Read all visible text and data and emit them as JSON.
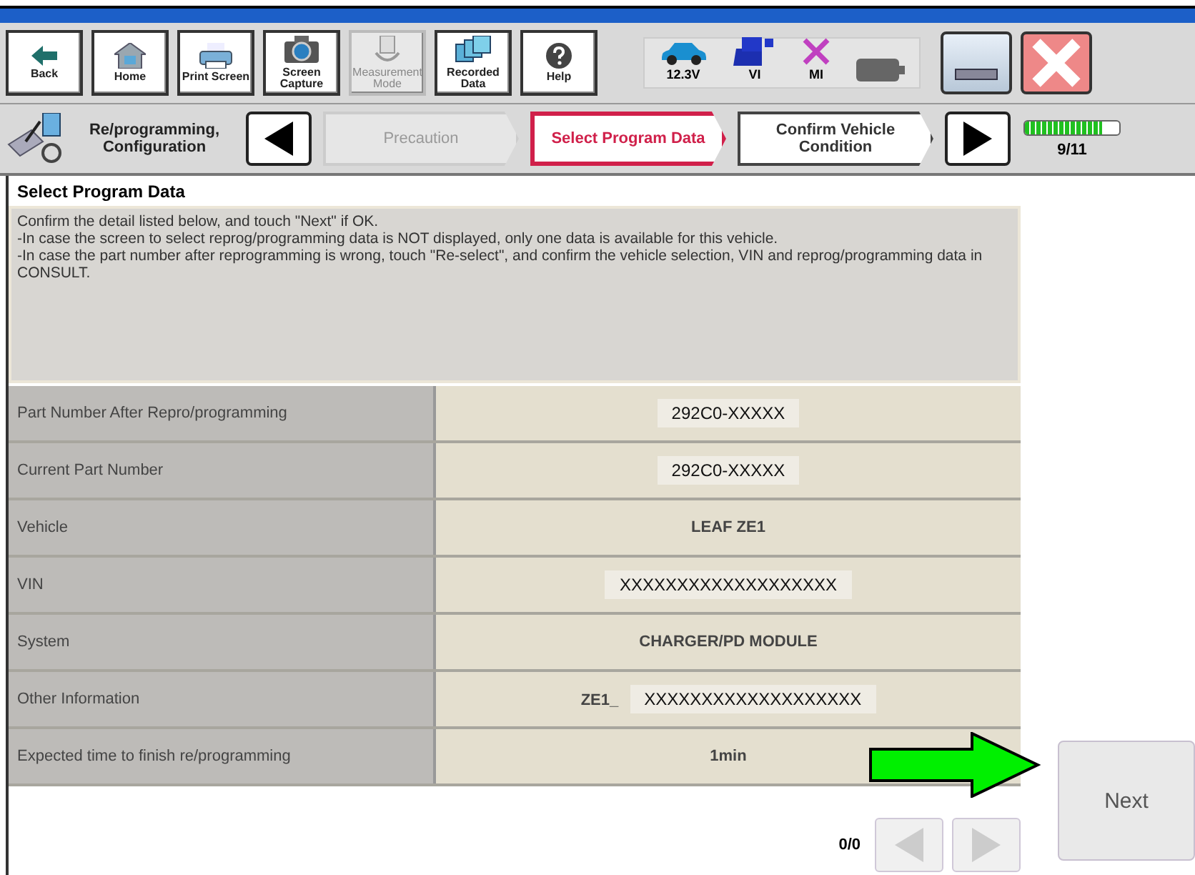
{
  "toolbar": {
    "buttons": [
      {
        "label": "Back",
        "kind": "back",
        "disabled": false
      },
      {
        "label": "Home",
        "kind": "home",
        "disabled": false
      },
      {
        "label": "Print Screen",
        "kind": "print",
        "disabled": false
      },
      {
        "label": "Screen Capture",
        "kind": "camera",
        "disabled": false
      },
      {
        "label": "Measurement Mode",
        "kind": "measure",
        "disabled": true
      },
      {
        "label": "Recorded Data",
        "kind": "folders",
        "disabled": false
      },
      {
        "label": "Help",
        "kind": "help",
        "disabled": false
      }
    ],
    "status": [
      {
        "label": "12.3V",
        "kind": "car"
      },
      {
        "label": "VI",
        "kind": "vi"
      },
      {
        "label": "MI",
        "kind": "mi"
      },
      {
        "kind": "battery"
      }
    ]
  },
  "breadcrumb": {
    "title": "Re/programming, Configuration",
    "steps": [
      {
        "label": "Precaution",
        "selected": false,
        "disabled": true
      },
      {
        "label": "Select Program Data",
        "selected": true,
        "disabled": false
      },
      {
        "label": "Confirm Vehicle Condition",
        "selected": false,
        "disabled": false
      }
    ],
    "progress": {
      "level": 0.82,
      "reading": "9/11"
    }
  },
  "page_title": "Select Program Data",
  "instructions": [
    "Confirm the detail listed below, and touch \"Next\" if OK.",
    "-In case the screen to select reprog/programming data is NOT displayed, only one data is available for this vehicle.",
    "-In case the part number after reprogramming is wrong, touch \"Re-select\", and confirm the vehicle selection, VIN and reprog/programming data in CONSULT."
  ],
  "table": {
    "rows": [
      {
        "label": "Part Number After Repro/programming",
        "value": "292C0-XXXXX",
        "redacted": true
      },
      {
        "label": "Current Part Number",
        "value": "292C0-XXXXX",
        "redacted": true
      },
      {
        "label": "Vehicle",
        "value": "LEAF ZE1",
        "redacted": false
      },
      {
        "label": "VIN",
        "value": "XXXXXXXXXXXXXXXXXXX",
        "redacted": true
      },
      {
        "label": "System",
        "value": "CHARGER/PD MODULE",
        "redacted": false
      },
      {
        "label": "Other Information",
        "prefix": "ZE1_",
        "value": "XXXXXXXXXXXXXXXXXXX",
        "redacted": true
      },
      {
        "label": "Expected time to finish re/programming",
        "value": "1min",
        "redacted": false
      }
    ]
  },
  "pager": {
    "reading": "0/0",
    "prev_disabled": true,
    "next_disabled": true
  },
  "next_button": {
    "label": "Next"
  }
}
